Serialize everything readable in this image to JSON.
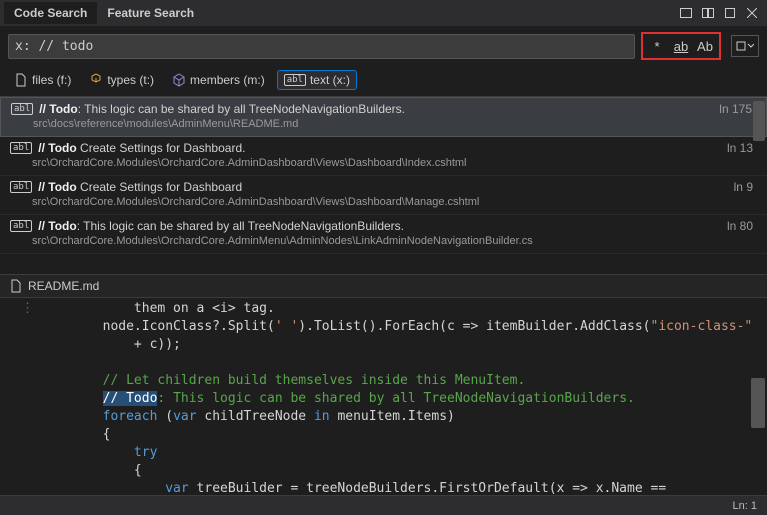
{
  "header": {
    "tabs": [
      {
        "label": "Code Search",
        "active": true
      },
      {
        "label": "Feature Search",
        "active": false
      }
    ]
  },
  "search": {
    "query": "x: // todo",
    "options": {
      "wildcard": "*",
      "whole_word": "ab",
      "match_case": "Ab"
    }
  },
  "filters": [
    {
      "label": "files (f:)",
      "icon": "file-icon",
      "active": false
    },
    {
      "label": "types (t:)",
      "icon": "types-icon",
      "active": false
    },
    {
      "label": "members (m:)",
      "icon": "cube-icon",
      "active": false
    },
    {
      "label": "text (x:)",
      "icon": "abl-icon",
      "active": true
    }
  ],
  "results": [
    {
      "prefix": "// Todo",
      "rest": ": This logic can be shared by all TreeNodeNavigationBuilders.",
      "path": "src\\docs\\reference\\modules\\AdminMenu\\README.md",
      "line": "ln 175",
      "selected": true
    },
    {
      "prefix": "// Todo",
      "rest": " Create Settings for Dashboard.",
      "path": "src\\OrchardCore.Modules\\OrchardCore.AdminDashboard\\Views\\Dashboard\\Index.cshtml",
      "line": "ln 13",
      "selected": false
    },
    {
      "prefix": "// Todo",
      "rest": " Create Settings for Dashboard",
      "path": "src\\OrchardCore.Modules\\OrchardCore.AdminDashboard\\Views\\Dashboard\\Manage.cshtml",
      "line": "ln 9",
      "selected": false
    },
    {
      "prefix": "// Todo",
      "rest": ": This logic can be shared by all TreeNodeNavigationBuilders.",
      "path": "src\\OrchardCore.Modules\\OrchardCore.AdminMenu\\AdminNodes\\LinkAdminNodeNavigationBuilder.cs",
      "line": "ln 80",
      "selected": false
    }
  ],
  "open_file": "README.md",
  "code": {
    "lines": [
      {
        "indent": "            ",
        "segs": [
          {
            "t": "them on a ",
            "c": ""
          },
          {
            "t": "<i>",
            "c": ""
          },
          {
            "t": " tag.",
            "c": ""
          }
        ]
      },
      {
        "indent": "        ",
        "segs": [
          {
            "t": "node.IconClass?.Split(",
            "c": ""
          },
          {
            "t": "' '",
            "c": "c-string"
          },
          {
            "t": ").ToList().ForEach(c => itemBuilder.AddClass(",
            "c": ""
          },
          {
            "t": "\"icon-class-\"",
            "c": "c-string"
          }
        ]
      },
      {
        "indent": "            ",
        "segs": [
          {
            "t": "+ c));",
            "c": ""
          }
        ]
      },
      {
        "indent": "",
        "segs": [
          {
            "t": "",
            "c": ""
          }
        ]
      },
      {
        "indent": "        ",
        "segs": [
          {
            "t": "// Let children build themselves inside this MenuItem.",
            "c": "c-comment"
          }
        ]
      },
      {
        "indent": "        ",
        "segs": [
          {
            "t": "// Todo",
            "c": "c-hl"
          },
          {
            "t": ": This logic can be shared by all TreeNodeNavigationBuilders.",
            "c": "c-comment"
          }
        ]
      },
      {
        "indent": "        ",
        "segs": [
          {
            "t": "foreach",
            "c": "c-keyword"
          },
          {
            "t": " (",
            "c": ""
          },
          {
            "t": "var",
            "c": "c-keyword"
          },
          {
            "t": " childTreeNode ",
            "c": ""
          },
          {
            "t": "in",
            "c": "c-keyword"
          },
          {
            "t": " menuItem.Items)",
            "c": ""
          }
        ]
      },
      {
        "indent": "        ",
        "segs": [
          {
            "t": "{",
            "c": ""
          }
        ]
      },
      {
        "indent": "            ",
        "segs": [
          {
            "t": "try",
            "c": "c-keyword"
          }
        ]
      },
      {
        "indent": "            ",
        "segs": [
          {
            "t": "{",
            "c": ""
          }
        ]
      },
      {
        "indent": "                ",
        "segs": [
          {
            "t": "var",
            "c": "c-keyword"
          },
          {
            "t": " treeBuilder = treeNodeBuilders.FirstOrDefault(x => x.Name ==",
            "c": ""
          }
        ]
      }
    ]
  },
  "status": {
    "position": "Ln: 1"
  }
}
